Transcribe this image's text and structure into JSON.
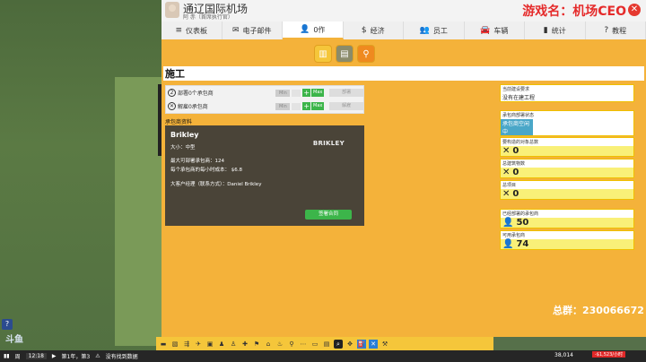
{
  "header": {
    "airport_name": "通辽国际机场",
    "airport_sub": "阿 赤（首席执行官）",
    "game_title": "游戏名：机场CEO"
  },
  "tabs": [
    {
      "label": "仪表板",
      "icon": "≡"
    },
    {
      "label": "电子邮件",
      "icon": "✉"
    },
    {
      "label": "0作",
      "icon": "👤"
    },
    {
      "label": "经济",
      "icon": "$"
    },
    {
      "label": "员工",
      "icon": "👥"
    },
    {
      "label": "车辆",
      "icon": "🚘"
    },
    {
      "label": "统计",
      "icon": "▮"
    },
    {
      "label": "教程",
      "icon": "?"
    }
  ],
  "page_title": "施工",
  "contractor_rows": [
    {
      "icon": "2",
      "label": "部署0个承包商",
      "min": "Min",
      "max": "Max",
      "action": "部署"
    },
    {
      "icon": "✕",
      "label": "解雇0承包商",
      "min": "Min",
      "max": "Max",
      "action": "解雇"
    }
  ],
  "section_label": "承包商资料",
  "card": {
    "name": "Brikley",
    "size": "大小：中型",
    "max_deploy": "最大可部署承包商：124",
    "hourly_cost": "每个承包商的每小时成本： $6.8",
    "manager": "大客户经理（联系方式）：Daniel Brikley",
    "logo": "BRIKLEY",
    "hire_button": "签署合同"
  },
  "stats": [
    {
      "label": "当前建设要求",
      "value": "没有在建工程"
    },
    {
      "label": "承包商部署状态",
      "value": "承包商空闲中"
    },
    {
      "label": "要构造的对象总数",
      "value": "0",
      "icon": "✕"
    },
    {
      "label": "总建筑物数",
      "value": "0",
      "icon": "✕"
    },
    {
      "label": "总项目",
      "value": "0",
      "icon": "✕"
    },
    {
      "label": "已经部署的承包商",
      "value": "50",
      "icon": "👤"
    },
    {
      "label": "可用承包商",
      "value": "74",
      "icon": "👤"
    }
  ],
  "group_text": "总群：230066672",
  "status": {
    "day": "周",
    "time": "12:18",
    "date": "第1年，第3",
    "message": "没有找到数据",
    "money": "38,014",
    "rate": "-$1,523/小时"
  },
  "watermark": "斗鱼"
}
